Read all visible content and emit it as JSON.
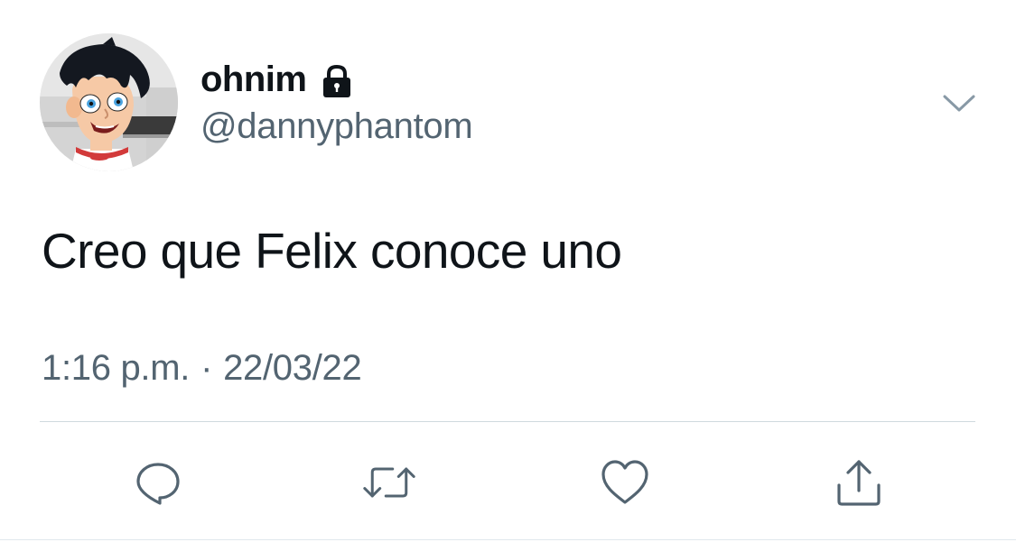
{
  "tweet": {
    "display_name": "ohnim",
    "handle": "@dannyphantom",
    "text": "Creo que Felix conoce uno",
    "time": "1:16 p.m.",
    "separator": "·",
    "date": "22/03/22",
    "account_locked": true
  },
  "icons": {
    "lock": "lock-icon",
    "more": "chevron-down-icon",
    "reply": "reply-icon",
    "retweet": "retweet-icon",
    "like": "heart-icon",
    "share": "share-icon"
  },
  "colors": {
    "primary_text": "#0f1419",
    "secondary_text": "#536471",
    "divider": "#cfd9de",
    "background": "#ffffff"
  }
}
